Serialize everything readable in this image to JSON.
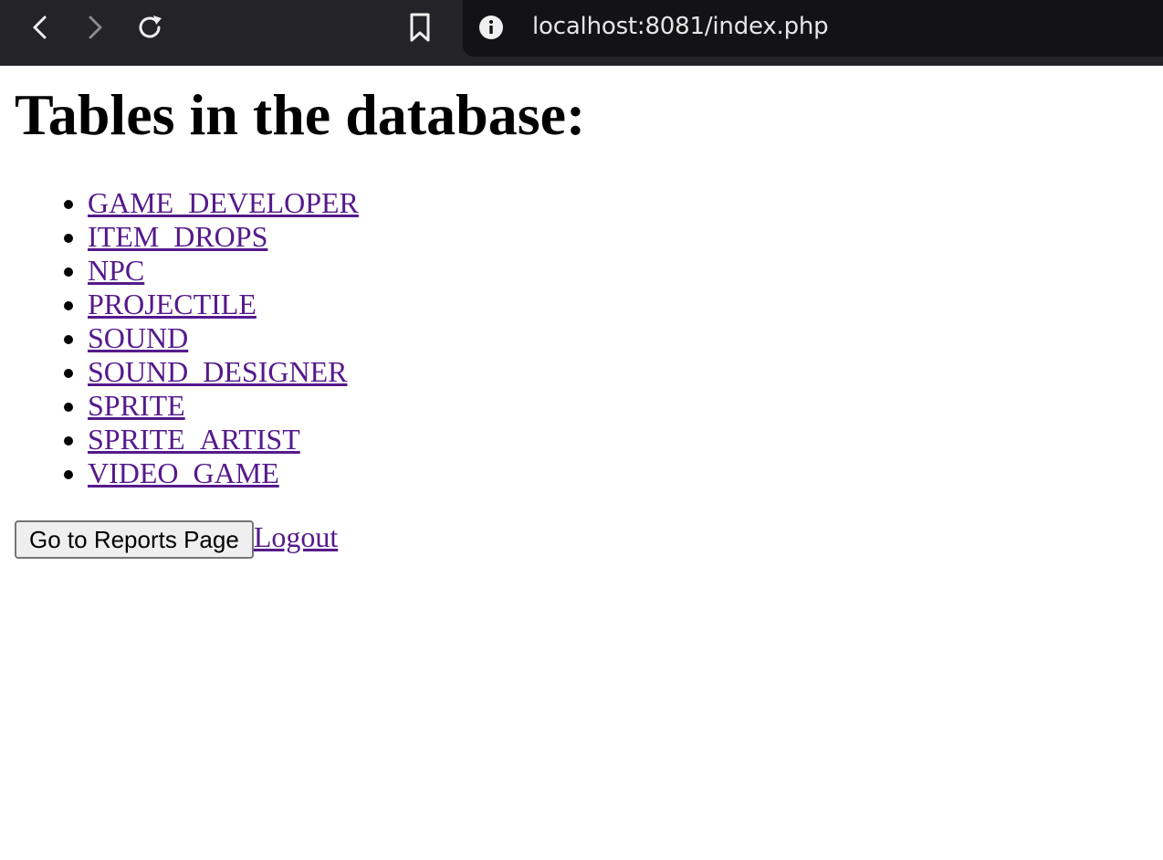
{
  "browser": {
    "url": "localhost:8081/index.php",
    "icons": {
      "back": "back-arrow-icon",
      "forward": "forward-arrow-icon",
      "reload": "reload-icon",
      "bookmark": "bookmark-icon",
      "site_info": "info-icon"
    },
    "colors": {
      "toolbar_bg": "#232328",
      "url_bg": "#131316",
      "url_text": "#e6e6e6",
      "forward_disabled": "#8a8a8e"
    }
  },
  "page": {
    "title": "Tables in the database:",
    "tables": [
      "GAME_DEVELOPER",
      "ITEM_DROPS",
      "NPC",
      "PROJECTILE",
      "SOUND",
      "SOUND_DESIGNER",
      "SPRITE",
      "SPRITE_ARTIST",
      "VIDEO_GAME"
    ],
    "reports_button_label": "Go to Reports Page",
    "logout_label": "Logout",
    "colors": {
      "visited_link": "#551a8b"
    }
  }
}
